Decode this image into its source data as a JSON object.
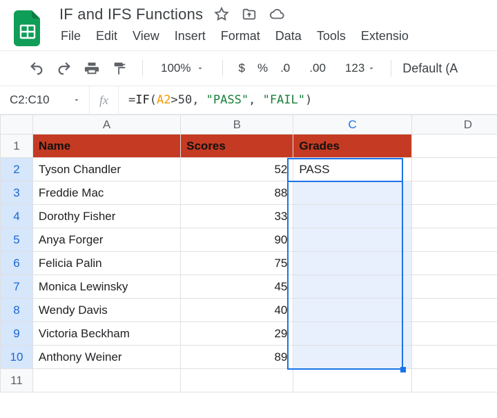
{
  "doc": {
    "title": "IF and IFS Functions"
  },
  "menus": {
    "file": "File",
    "edit": "Edit",
    "view": "View",
    "insert": "Insert",
    "format": "Format",
    "data": "Data",
    "tools": "Tools",
    "extensions": "Extensio"
  },
  "toolbar": {
    "zoom": "100%",
    "dollar": "$",
    "percent": "%",
    "dec_dec": ".0",
    "inc_dec": ".00",
    "numfmt": "123",
    "font": "Default (A"
  },
  "namebox": {
    "range": "C2:C10"
  },
  "formula": {
    "eq": "=",
    "fn": "IF",
    "ref": "A2",
    "op": ">50",
    "arg2": "\"PASS\"",
    "arg3": "\"FAIL\""
  },
  "columns": {
    "A": "A",
    "B": "B",
    "C": "C",
    "D": "D"
  },
  "headers": {
    "name": "Name",
    "scores": "Scores",
    "grades": "Grades"
  },
  "rows": [
    {
      "n": "2",
      "name": "Tyson Chandler",
      "score": "52",
      "grade": "PASS"
    },
    {
      "n": "3",
      "name": "Freddie Mac",
      "score": "88",
      "grade": ""
    },
    {
      "n": "4",
      "name": "Dorothy Fisher",
      "score": "33",
      "grade": ""
    },
    {
      "n": "5",
      "name": "Anya Forger",
      "score": "90",
      "grade": ""
    },
    {
      "n": "6",
      "name": "Felicia Palin",
      "score": "75",
      "grade": ""
    },
    {
      "n": "7",
      "name": "Monica Lewinsky",
      "score": "45",
      "grade": ""
    },
    {
      "n": "8",
      "name": "Wendy Davis",
      "score": "40",
      "grade": ""
    },
    {
      "n": "9",
      "name": "Victoria Beckham",
      "score": "29",
      "grade": ""
    },
    {
      "n": "10",
      "name": "Anthony Weiner",
      "score": "89",
      "grade": ""
    }
  ],
  "row1": "1",
  "row11": "11"
}
